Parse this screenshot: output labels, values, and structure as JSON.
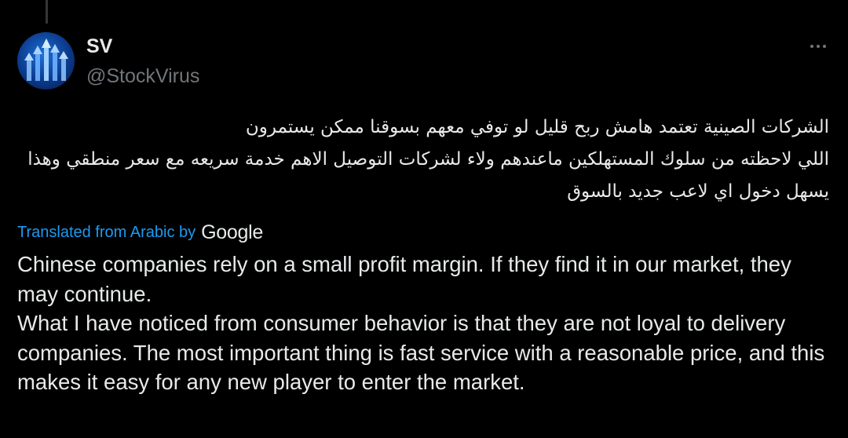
{
  "author": {
    "display_name": "SV",
    "handle": "@StockVirus",
    "avatar_icon": "stock-arrows-logo"
  },
  "menu": {
    "icon": "more-horizontal-icon"
  },
  "tweet": {
    "original_text": "الشركات الصينية تعتمد هامش ربح قليل لو توفي معهم بسوقنا ممكن يستمرون\nاللي لاحظته من سلوك المستهلكين ماعندهم ولاء لشركات التوصيل الاهم خدمة سريعه مع سعر منطقي وهذا\nيسهل دخول اي لاعب جديد بالسوق",
    "translation_label": "Translated from Arabic by",
    "translation_provider": "Google",
    "translated_text": "Chinese companies rely on a small profit margin. If they find it in our market, they may continue.\nWhat I have noticed from consumer behavior is that they are not loyal to delivery companies. The most important thing is fast service with a reasonable price, and this makes it easy for any new player to enter the market."
  },
  "colors": {
    "background": "#000000",
    "text_primary": "#e7e9ea",
    "text_secondary": "#71767b",
    "link": "#1d9bf0",
    "avatar_blue": "#1f6fd6"
  }
}
